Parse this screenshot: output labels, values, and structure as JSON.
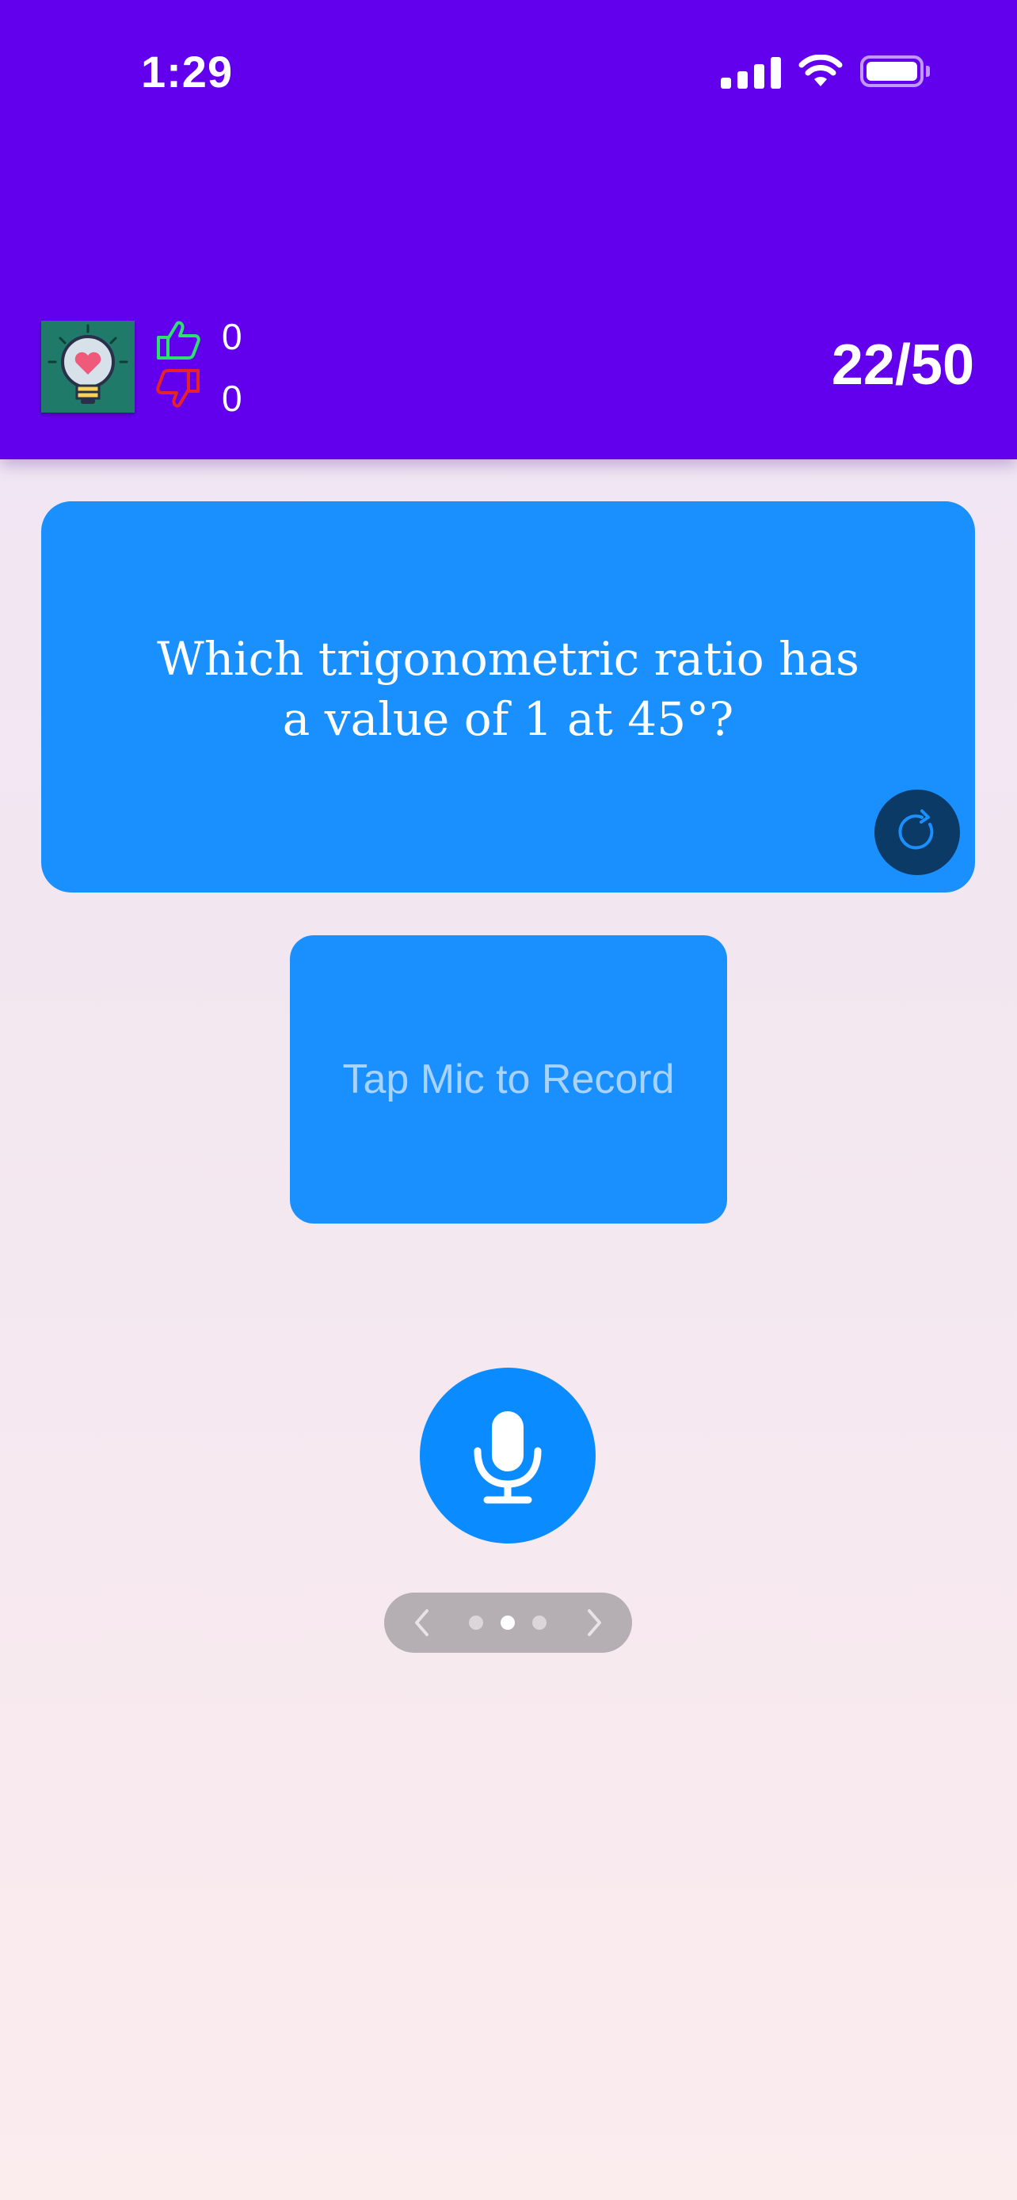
{
  "status_bar": {
    "time": "1:29"
  },
  "header": {
    "likes": "0",
    "dislikes": "0",
    "progress": "22/50",
    "colors": {
      "background": "#6200EE",
      "thumb_up": "#2ee06e",
      "thumb_down": "#e8222a"
    }
  },
  "question": {
    "text": "Which trigonometric ratio has a value of 1 at 45°?",
    "card_color": "#1A90FF",
    "refresh_icon": "refresh-icon"
  },
  "record": {
    "label": "Tap Mic to Record",
    "mic_icon": "microphone-icon"
  },
  "pager": {
    "current_page": 2,
    "total_pages": 3
  }
}
